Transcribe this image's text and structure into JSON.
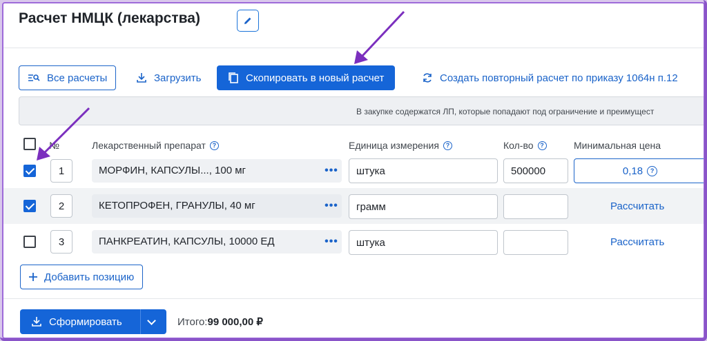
{
  "page": {
    "title": "Расчет НМЦК (лекарства)"
  },
  "toolbar": {
    "all_calcs": "Все расчеты",
    "upload": "Загрузить",
    "copy_new": "Скопировать в новый расчет",
    "repeat_calc": "Создать повторный расчет по приказу 1064н п.12"
  },
  "notice": "В закупке содержатся ЛП, которые попадают под ограничение и преимущест",
  "table": {
    "headers": {
      "num": "№",
      "drug": "Лекарственный препарат",
      "unit": "Единица измерения",
      "qty": "Кол-во",
      "min_price": "Минимальная цена"
    },
    "rows": [
      {
        "checked": true,
        "num": "1",
        "drug": "МОРФИН, КАПСУЛЫ..., 100 мг",
        "unit": "штука",
        "qty": "500000",
        "price": "0,18"
      },
      {
        "checked": true,
        "num": "2",
        "drug": "КЕТОПРОФЕН, ГРАНУЛЫ, 40 мг",
        "unit": "грамм",
        "qty": "",
        "price_link": "Рассчитать"
      },
      {
        "checked": false,
        "num": "3",
        "drug": "ПАНКРЕАТИН, КАПСУЛЫ, 10000 ЕД",
        "unit": "штука",
        "qty": "",
        "price_link": "Рассчитать"
      }
    ]
  },
  "add_position": "Добавить позицию",
  "form_button": "Сформировать",
  "total": {
    "label": "Итого:",
    "value": "99 000,00 ₽"
  },
  "colors": {
    "accent": "#1565d8",
    "annotation_arrow": "#7b2fbe"
  }
}
